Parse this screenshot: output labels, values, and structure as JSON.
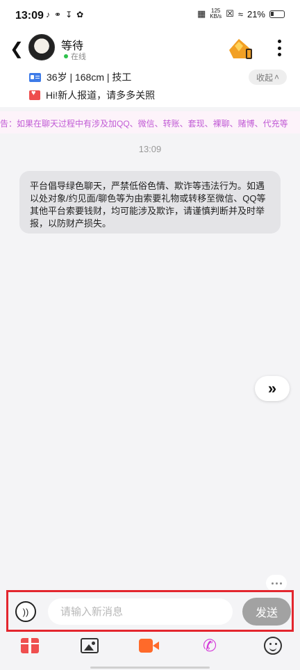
{
  "status_bar": {
    "time": "13:09",
    "net_speed_value": "125",
    "net_speed_unit": "KB/s",
    "battery": "21%"
  },
  "header": {
    "user_name": "等待",
    "online_status": "在线",
    "info_line": "36岁 | 168cm | 技工",
    "greeting_line": "Hi!新人报道，请多多关照",
    "collapse_label": "收起"
  },
  "notice": {
    "text": "告：如果在聊天过程中有涉及加QQ、微信、转账、套现、裸聊、赌博、代充等"
  },
  "chat": {
    "time_label": "13:09",
    "system_message": "平台倡导绿色聊天，严禁低俗色情、欺诈等违法行为。如遇以处对象/约见面/聊色等为由索要礼物或转移至微信、QQ等其他平台索要钱财，均可能涉及欺诈，请谨慎判断并及时举报，以防财产损失。"
  },
  "composer": {
    "placeholder": "请输入新消息",
    "value": "",
    "send_label": "发送"
  },
  "toolbar": {
    "icons": [
      "gift-icon",
      "image-icon",
      "video-call-icon",
      "voice-call-icon",
      "emoji-icon"
    ]
  },
  "colors": {
    "notice_text": "#c15bd5",
    "highlight_border": "#e3262e",
    "send_button": "#a2a2a2",
    "online_dot": "#2ec24c"
  }
}
